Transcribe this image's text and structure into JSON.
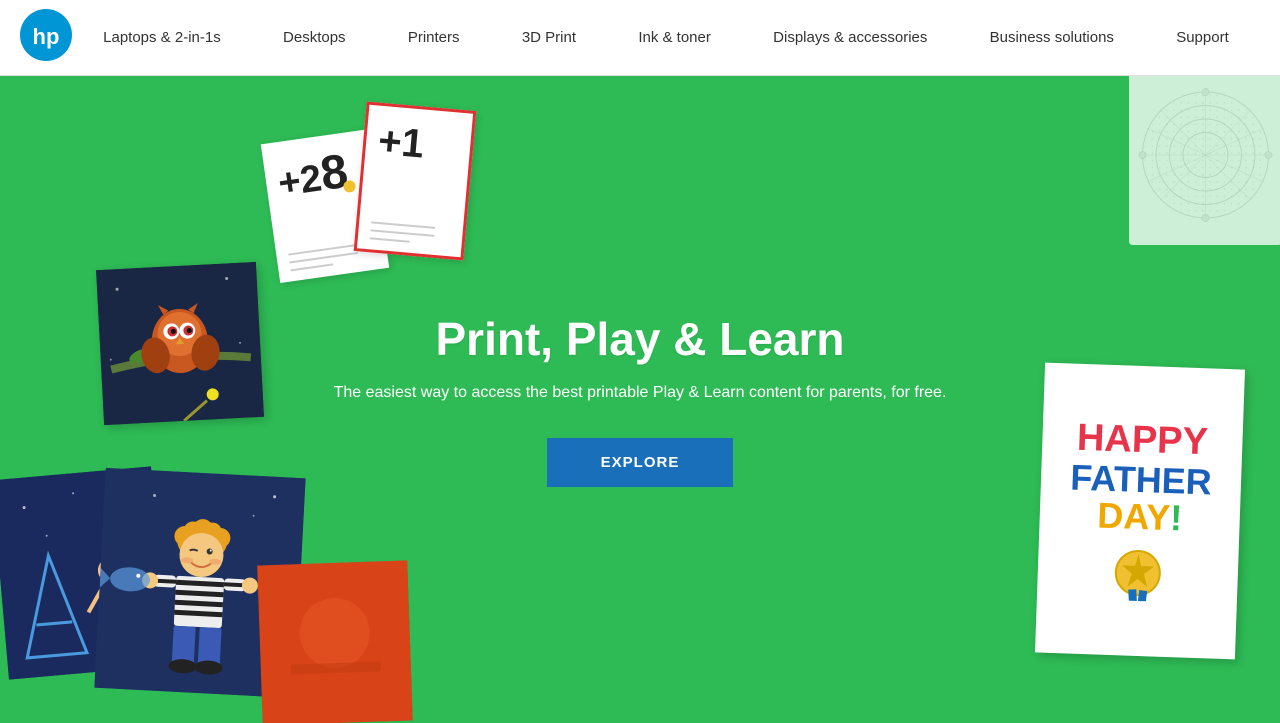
{
  "navbar": {
    "logo_alt": "HP Logo",
    "nav_items": [
      {
        "id": "laptops",
        "label": "Laptops & 2-in-1s"
      },
      {
        "id": "desktops",
        "label": "Desktops"
      },
      {
        "id": "printers",
        "label": "Printers"
      },
      {
        "id": "3dprint",
        "label": "3D Print"
      },
      {
        "id": "ink",
        "label": "Ink & toner"
      },
      {
        "id": "displays",
        "label": "Displays & accessories"
      },
      {
        "id": "business",
        "label": "Business solutions"
      },
      {
        "id": "support",
        "label": "Support"
      }
    ]
  },
  "hero": {
    "title": "Print, Play & Learn",
    "subtitle": "The easiest way to access the best printable Play & Learn content for parents, for free.",
    "cta_label": "EXPLORE",
    "bg_color": "#2ebb55",
    "btn_color": "#1a6fba"
  },
  "decorative": {
    "math_card_1": "+2 8",
    "math_card_2": "+1",
    "fathers_day": {
      "line1": "HAPPY",
      "line2": "FATHER",
      "line3": "DAY",
      "line4": "!"
    }
  }
}
